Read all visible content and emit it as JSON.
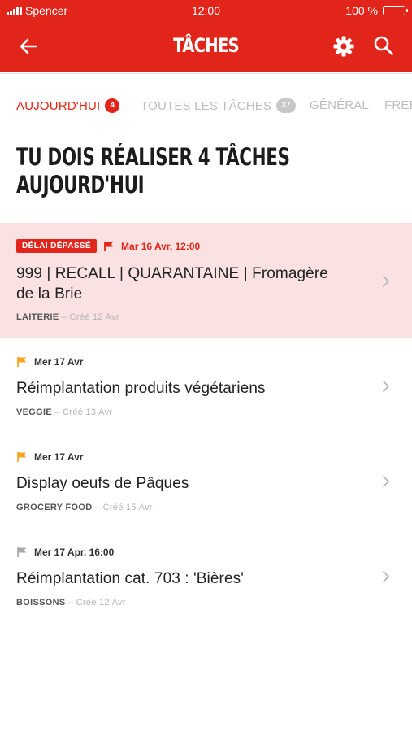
{
  "status_bar": {
    "carrier": "Spencer",
    "time": "12:00",
    "battery": "100 %"
  },
  "header": {
    "title": "TÂCHES",
    "back_icon": "arrow-left-icon",
    "settings_icon": "gear-icon",
    "search_icon": "search-icon"
  },
  "tabs": [
    {
      "label": "AUJOURD'HUI",
      "count": "4"
    },
    {
      "label": "TOUTES LES TÂCHES",
      "count": "37"
    },
    {
      "label": "GÉNÉRAL",
      "count": ""
    },
    {
      "label": "FREE",
      "count": ""
    }
  ],
  "heading": {
    "line1": "TU DOIS RÉALISER 4 TÂCHES",
    "line2": "AUJOURD'HUI"
  },
  "tasks": [
    {
      "overdue_tag": "DÉLAI DÉPASSÉ",
      "date": "Mar 16 Avr, 12:00",
      "name_line1": "999 | RECALL | QUARANTAINE | Fromagère",
      "name_line2": "de la Brie",
      "category": "LAITERIE",
      "created": "– Créé 12 Avr",
      "flag_color": "#e1251b"
    },
    {
      "date": "Mer 17 Avr",
      "name": "Réimplantation produits végétariens",
      "category": "VEGGIE",
      "created": "– Créé 13 Avr",
      "flag_color": "#f5a623"
    },
    {
      "date": "Mer 17 Avr",
      "name": "Display oeufs de Pâques",
      "category": "GROCERY FOOD",
      "created": "– Créé 15 Avr",
      "flag_color": "#f5a623"
    },
    {
      "date": "Mer 17 Apr, 16:00",
      "name": "Réimplantation cat. 703 : 'Bières'",
      "category": "BOISSONS",
      "created": "– Créé 12 Avr",
      "flag_color": "#a9a9a9"
    }
  ],
  "colors": {
    "brand": "#e1251b",
    "overdue_bg": "#fbe2e2"
  }
}
